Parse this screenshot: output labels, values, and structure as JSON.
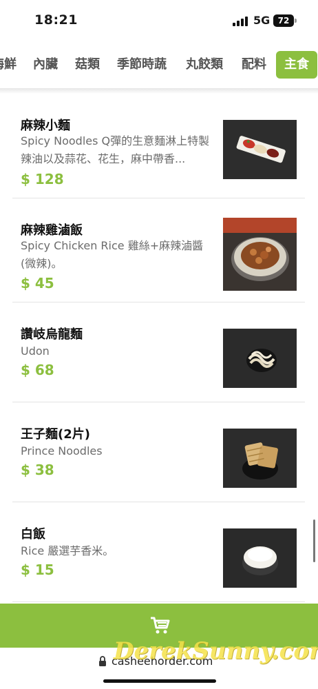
{
  "status_bar": {
    "time": "18:21",
    "network": "5G",
    "battery": "72"
  },
  "tabs": [
    {
      "label": "海鮮",
      "active": false
    },
    {
      "label": "內臟",
      "active": false
    },
    {
      "label": "菇類",
      "active": false
    },
    {
      "label": "季節時蔬",
      "active": false
    },
    {
      "label": "丸餃類",
      "active": false
    },
    {
      "label": "配料",
      "active": false
    },
    {
      "label": "主食",
      "active": true
    }
  ],
  "menu": {
    "items": [
      {
        "name": "麻辣小麵",
        "desc": "Spicy Noodles Q彈的生意麵淋上特製辣油以及蒜花、花生，麻中帶香...",
        "price": "$ 128"
      },
      {
        "name": "麻辣雞滷飯",
        "desc": "Spicy Chicken Rice 雞絲+麻辣滷醬(微辣)。",
        "price": "$ 45"
      },
      {
        "name": "讚岐烏龍麵",
        "desc": "Udon",
        "price": "$ 68"
      },
      {
        "name": "王子麵(2片)",
        "desc": "Prince Noodles",
        "price": "$ 38"
      },
      {
        "name": "白飯",
        "desc": "Rice 嚴選芋香米。",
        "price": "$ 15"
      }
    ]
  },
  "cart": {
    "icon": "cart-icon"
  },
  "browser": {
    "url": "casheehorder.com"
  },
  "watermark": "DerekSunny.com",
  "colors": {
    "accent": "#8cbf3f",
    "price": "#8cbf3f"
  }
}
